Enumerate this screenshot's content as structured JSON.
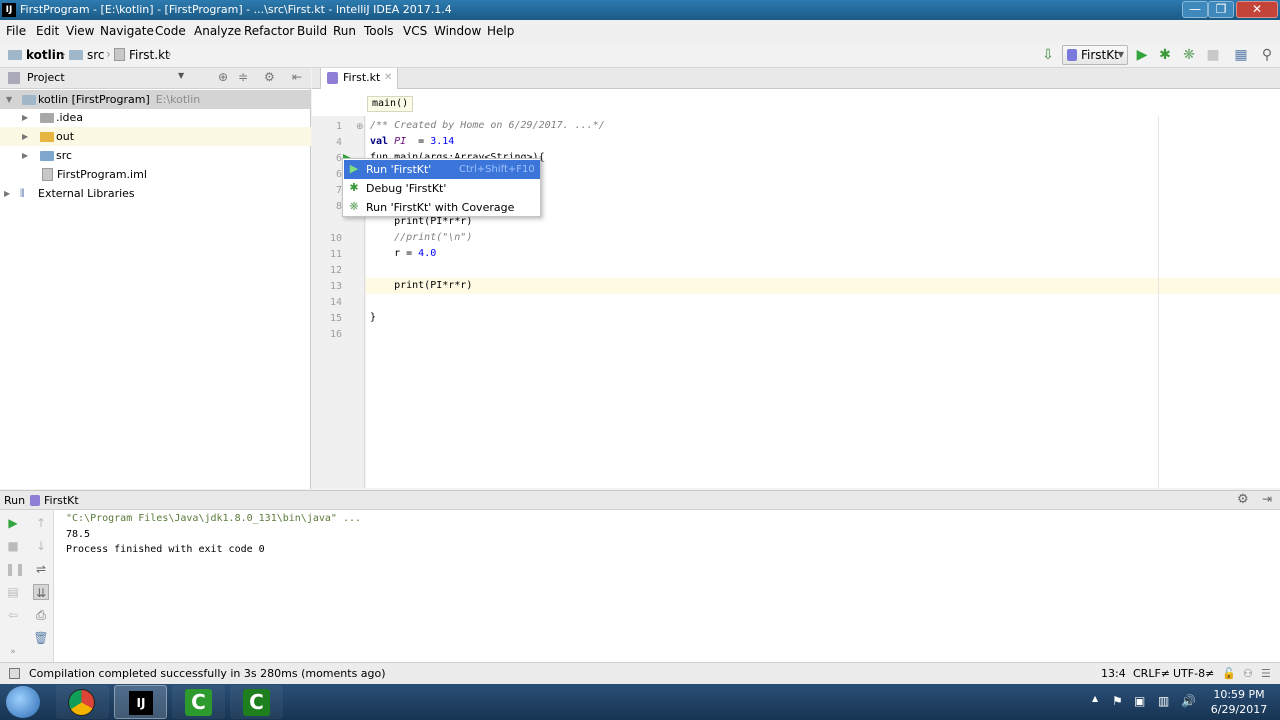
{
  "window": {
    "title": "FirstProgram - [E:\\kotlin] - [FirstProgram] - ...\\src\\First.kt - IntelliJ IDEA 2017.1.4",
    "min_glyph": "—",
    "max_glyph": "❐",
    "close_glyph": "✕"
  },
  "menu": [
    "File",
    "Edit",
    "View",
    "Navigate",
    "Code",
    "Analyze",
    "Refactor",
    "Build",
    "Run",
    "Tools",
    "VCS",
    "Window",
    "Help"
  ],
  "nav": {
    "crumbs": [
      "kotlin",
      "src",
      "First.kt"
    ],
    "run_config": "FirstKt"
  },
  "project": {
    "header": "Project",
    "tree": [
      {
        "label": "kotlin [FirstProgram]",
        "hint": "E:\\kotlin"
      },
      {
        "label": ".idea"
      },
      {
        "label": "out"
      },
      {
        "label": "src"
      },
      {
        "label": "FirstProgram.iml"
      },
      {
        "label": "External Libraries"
      }
    ]
  },
  "editor": {
    "tab": "First.kt",
    "breadcrumb": "main()",
    "line_numbers": [
      "1",
      "4",
      "6",
      "6",
      "7",
      "8",
      "10",
      "11",
      "12",
      "13",
      "14",
      "15",
      "16"
    ]
  },
  "code": {
    "l1": "/** Created by Home on 6/29/2017. ...*/",
    "l4a": "val ",
    "l4b": "PI",
    "l4c": "  = ",
    "l4d": "3.14",
    "l6": "fun main(args:Array<String>){",
    "l8": "    print(PI*r*r)",
    "l10": "    //print(\"\\n\")",
    "l11a": "    r = ",
    "l11b": "4.0",
    "l13": "    print(PI*r*r)",
    "l15": "}"
  },
  "context_menu": [
    {
      "label": "Run 'FirstKt'",
      "shortcut": "Ctrl+Shift+F10"
    },
    {
      "label": "Debug 'FirstKt'"
    },
    {
      "label": "Run 'FirstKt' with Coverage"
    }
  ],
  "run_panel": {
    "title": "Run",
    "config": "FirstKt",
    "console": [
      "\"C:\\Program Files\\Java\\jdk1.8.0_131\\bin\\java\" ...",
      "78.5",
      "Process finished with exit code 0"
    ]
  },
  "status": {
    "message": "Compilation completed successfully in 3s 280ms (moments ago)",
    "position": "13:4",
    "line_sep": "CRLF≠",
    "encoding": "UTF-8≠"
  },
  "taskbar": {
    "time": "10:59 PM",
    "date": "6/29/2017"
  },
  "colors": {
    "accent": "#3c75d9",
    "run_green": "#31a53b",
    "titlebar": "#1c5f8a"
  }
}
